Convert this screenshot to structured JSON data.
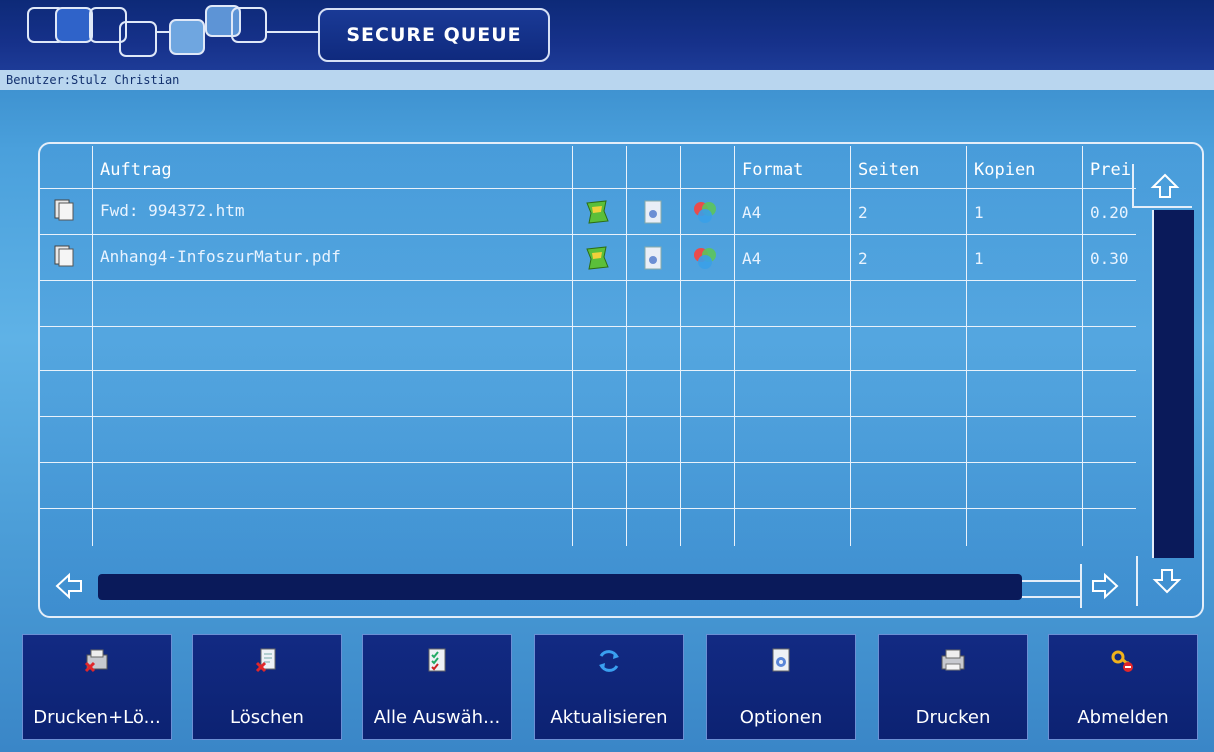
{
  "header": {
    "title": "SECURE QUEUE"
  },
  "user_bar": {
    "label": "Benutzer:Stulz Christian"
  },
  "table": {
    "columns": {
      "job": "Auftrag",
      "format": "Format",
      "pages": "Seiten",
      "copies": "Kopien",
      "price": "Preis"
    },
    "rows": [
      {
        "name": "Fwd: 994372.htm",
        "format": "A4",
        "pages": "2",
        "copies": "1",
        "price": "0.20"
      },
      {
        "name": "Anhang4-InfoszurMatur.pdf",
        "format": "A4",
        "pages": "2",
        "copies": "1",
        "price": "0.30"
      }
    ]
  },
  "buttons": {
    "print_delete": "Drucken+Lö...",
    "delete": "Löschen",
    "select_all": "Alle Auswäh...",
    "refresh": "Aktualisieren",
    "options": "Optionen",
    "print": "Drucken",
    "logout": "Abmelden"
  },
  "icons": {
    "row_doc": "document-icon",
    "flag": "green-flag-icon",
    "settings_doc": "settings-document-icon",
    "color": "color-circles-icon"
  }
}
